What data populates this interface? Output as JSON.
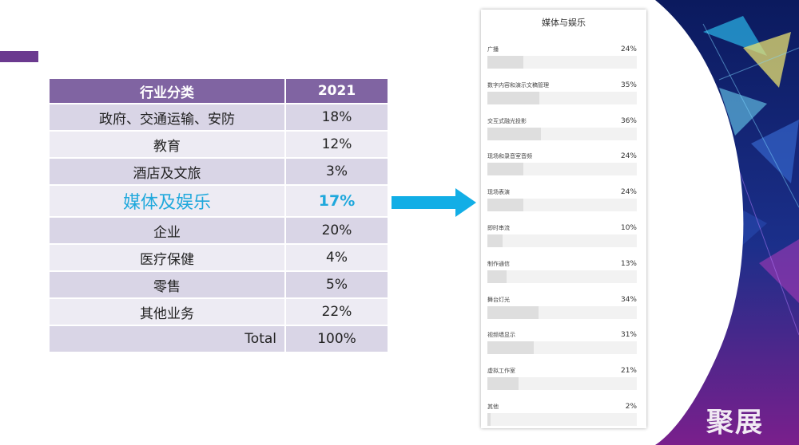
{
  "table": {
    "headers": [
      "行业分类",
      "2021"
    ],
    "rows": [
      {
        "name": "政府、交通运输、安防",
        "value": "18%"
      },
      {
        "name": "教育",
        "value": "12%"
      },
      {
        "name": "酒店及文旅",
        "value": "3%"
      },
      {
        "name": "媒体及娱乐",
        "value": "17%"
      },
      {
        "name": "企业",
        "value": "20%"
      },
      {
        "name": "医疗保健",
        "value": "4%"
      },
      {
        "name": "零售",
        "value": "5%"
      },
      {
        "name": "其他业务",
        "value": "22%"
      },
      {
        "name": "Total",
        "value": "100%"
      }
    ],
    "highlight_color": "#1fa8dc",
    "header_color": "#8064a2"
  },
  "chart_data": {
    "type": "bar",
    "title": "媒体与娱乐",
    "categories": [
      "广播",
      "数字内容和演示文稿管理",
      "交互式融光投影",
      "现场和录音室音频",
      "现场表演",
      "即时串流",
      "制作通信",
      "舞台灯光",
      "视频墙显示",
      "虚拟工作室",
      "其他"
    ],
    "values": [
      24,
      35,
      36,
      24,
      24,
      10,
      13,
      34,
      31,
      21,
      2
    ],
    "value_labels": [
      "24%",
      "35%",
      "36%",
      "24%",
      "24%",
      "10%",
      "13%",
      "34%",
      "31%",
      "21%",
      "2%"
    ],
    "ylim": [
      0,
      100
    ]
  },
  "logo": {
    "text": "聚展"
  }
}
